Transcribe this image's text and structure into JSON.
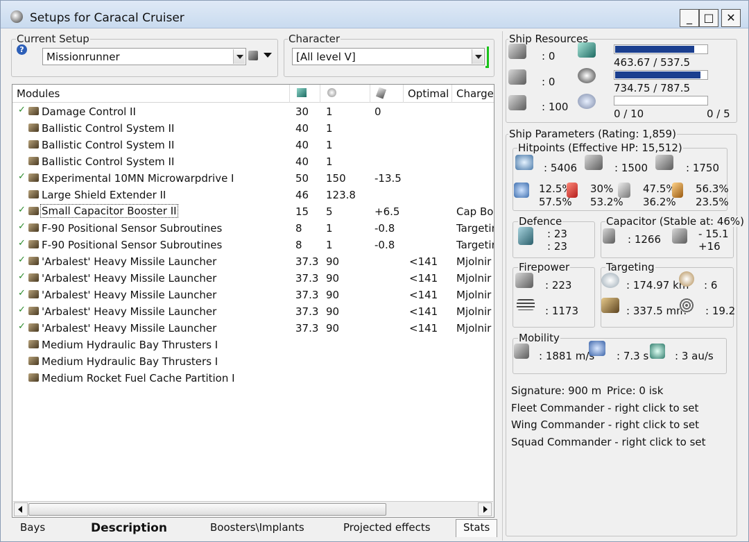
{
  "window": {
    "title": "Setups for Caracal Cruiser",
    "min": "_",
    "max": "□",
    "close": "✕"
  },
  "setup": {
    "legend": "Current Setup",
    "value": "Missionrunner"
  },
  "character": {
    "legend": "Character",
    "value": "[All level V]"
  },
  "list": {
    "headers": [
      "Modules",
      "",
      "",
      "",
      "Optimal",
      "Charges"
    ],
    "rows": [
      {
        "check": "✓",
        "name": "Damage Control II",
        "c1": "30",
        "c2": "1",
        "c3": "0",
        "c4": "",
        "c5": ""
      },
      {
        "check": "",
        "name": "Ballistic Control System II",
        "c1": "40",
        "c2": "1",
        "c3": "",
        "c4": "",
        "c5": ""
      },
      {
        "check": "",
        "name": "Ballistic Control System II",
        "c1": "40",
        "c2": "1",
        "c3": "",
        "c4": "",
        "c5": ""
      },
      {
        "check": "",
        "name": "Ballistic Control System II",
        "c1": "40",
        "c2": "1",
        "c3": "",
        "c4": "",
        "c5": ""
      },
      {
        "check": "✓",
        "name": "Experimental 10MN Microwarpdrive I",
        "c1": "50",
        "c2": "150",
        "c3": "-13.5",
        "c4": "",
        "c5": ""
      },
      {
        "check": "",
        "name": "Large Shield Extender II",
        "c1": "46",
        "c2": "123.8",
        "c3": "",
        "c4": "",
        "c5": ""
      },
      {
        "check": "✓",
        "name": "Small Capacitor Booster II",
        "c1": "15",
        "c2": "5",
        "c3": "+6.5",
        "c4": "",
        "c5": "Cap Boo"
      },
      {
        "check": "✓",
        "name": "F-90 Positional Sensor Subroutines",
        "c1": "8",
        "c2": "1",
        "c3": "-0.8",
        "c4": "",
        "c5": "Targetin"
      },
      {
        "check": "✓",
        "name": "F-90 Positional Sensor Subroutines",
        "c1": "8",
        "c2": "1",
        "c3": "-0.8",
        "c4": "",
        "c5": "Targetin"
      },
      {
        "check": "✓",
        "name": "'Arbalest' Heavy Missile Launcher",
        "c1": "37.3",
        "c2": "90",
        "c3": "",
        "c4": "<141",
        "c5": "Mjolnir H"
      },
      {
        "check": "✓",
        "name": "'Arbalest' Heavy Missile Launcher",
        "c1": "37.3",
        "c2": "90",
        "c3": "",
        "c4": "<141",
        "c5": "Mjolnir H"
      },
      {
        "check": "✓",
        "name": "'Arbalest' Heavy Missile Launcher",
        "c1": "37.3",
        "c2": "90",
        "c3": "",
        "c4": "<141",
        "c5": "Mjolnir H"
      },
      {
        "check": "✓",
        "name": "'Arbalest' Heavy Missile Launcher",
        "c1": "37.3",
        "c2": "90",
        "c3": "",
        "c4": "<141",
        "c5": "Mjolnir H"
      },
      {
        "check": "✓",
        "name": "'Arbalest' Heavy Missile Launcher",
        "c1": "37.3",
        "c2": "90",
        "c3": "",
        "c4": "<141",
        "c5": "Mjolnir H"
      },
      {
        "check": "",
        "name": "Medium Hydraulic Bay Thrusters I",
        "c1": "",
        "c2": "",
        "c3": "",
        "c4": "",
        "c5": ""
      },
      {
        "check": "",
        "name": "Medium Hydraulic Bay Thrusters I",
        "c1": "",
        "c2": "",
        "c3": "",
        "c4": "",
        "c5": ""
      },
      {
        "check": "",
        "name": "Medium Rocket Fuel Cache Partition I",
        "c1": "",
        "c2": "",
        "c3": "",
        "c4": "",
        "c5": ""
      }
    ]
  },
  "tabs": [
    "Bays",
    "Description",
    "Boosters\\Implants",
    "Projected effects",
    "Stats"
  ],
  "resources": {
    "legend": "Ship Resources",
    "hi": ": 0",
    "med": ": 0",
    "calib": ": 100",
    "cpu": {
      "text": "463.67 / 537.5",
      "fraction": 0.863
    },
    "power": {
      "text": "734.75 / 787.5",
      "fraction": 0.933
    },
    "drone_bw": "0 / 10",
    "drone_bay": "0 / 5"
  },
  "params": {
    "legend": "Ship Parameters (Rating: 1,859)",
    "hp": {
      "legend": "Hitpoints (Effective HP: 15,512)",
      "shield": ": 5406",
      "armor": ": 1500",
      "structure": ": 1750",
      "resists": [
        "12.5%",
        "57.5%",
        "30%",
        "53.2%",
        "47.5%",
        "36.2%",
        "56.3%",
        "23.5%"
      ]
    },
    "defence": {
      "legend": "Defence",
      "a": ": 23",
      "b": ": 23"
    },
    "capacitor": {
      "legend": "Capacitor (Stable at: 46%)",
      "cap": ": 1266",
      "delta": "- 15.1",
      "plus": "+16"
    },
    "firepower": {
      "legend": "Firepower",
      "a": ": 223",
      "b": ": 1173"
    },
    "targeting": {
      "legend": "Targeting",
      "range": ": 174.97 km",
      "targets": ": 6",
      "scan": ": 337.5 mm",
      "sensor": ": 19.2"
    },
    "mobility": {
      "legend": "Mobility",
      "speed": ": 1881 m/s",
      "align": ": 7.3 s",
      "warp": ": 3 au/s"
    },
    "signature": "Signature: 900 m",
    "price": "Price: 0 isk",
    "fleet": "Fleet Commander - right click to set",
    "wing": "Wing Commander - right click to set",
    "squad": "Squad Commander - right click to set"
  },
  "colors": {
    "bar": "#1b3f8f",
    "check": "#2a8a2a",
    "caption": "#c9dbef"
  }
}
